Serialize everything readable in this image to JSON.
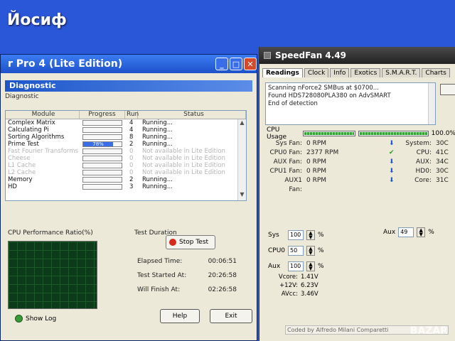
{
  "watermark": "Йосиф",
  "watermark_br": "BAZAR",
  "diag_window": {
    "title": "r Pro 4 (Lite Edition)",
    "banner": "Diagnostic",
    "sub": "Diagnostic",
    "columns": [
      "Module",
      "Progress",
      "Run",
      "Status"
    ],
    "rows": [
      {
        "module": "Complex Matrix",
        "progress": "",
        "fill": 0,
        "run": "4",
        "status": "Running...",
        "dim": false
      },
      {
        "module": "Calculating Pi",
        "progress": "",
        "fill": 0,
        "run": "4",
        "status": "Running...",
        "dim": false
      },
      {
        "module": "Sorting Algorithms",
        "progress": "",
        "fill": 0,
        "run": "8",
        "status": "Running...",
        "dim": false
      },
      {
        "module": "Prime Test",
        "progress": "78%",
        "fill": 78,
        "run": "2",
        "status": "Running...",
        "dim": false
      },
      {
        "module": "Fast Fourier Transforms",
        "progress": "",
        "fill": 0,
        "run": "0",
        "status": "Not available in Lite Edition",
        "dim": true
      },
      {
        "module": "Cheese",
        "progress": "",
        "fill": 0,
        "run": "0",
        "status": "Not available in Lite Edition",
        "dim": true
      },
      {
        "module": "L1 Cache",
        "progress": "",
        "fill": 0,
        "run": "0",
        "status": "Not available in Lite Edition",
        "dim": true
      },
      {
        "module": "L2 Cache",
        "progress": "",
        "fill": 0,
        "run": "0",
        "status": "Not available in Lite Edition",
        "dim": true
      },
      {
        "module": "Memory",
        "progress": "",
        "fill": 0,
        "run": "2",
        "status": "Running...",
        "dim": false
      },
      {
        "module": "HD",
        "progress": "",
        "fill": 0,
        "run": "3",
        "status": "Running...",
        "dim": false
      }
    ],
    "perf_label": "CPU Performance Ratio(%)",
    "duration_label": "Test Duration",
    "stop_label": "Stop Test",
    "elapsed_label": "Elapsed Time:",
    "elapsed_value": "00:06:51",
    "started_label": "Test Started At:",
    "started_value": "20:26:58",
    "finish_label": "Will Finish At:",
    "finish_value": "02:26:58",
    "help_label": "Help",
    "exit_label": "Exit",
    "showlog_label": "Show Log"
  },
  "speedfan": {
    "title": "SpeedFan 4.49",
    "tabs": [
      "Readings",
      "Clock",
      "Info",
      "Exotics",
      "S.M.A.R.T.",
      "Charts"
    ],
    "log_lines": [
      "Scanning nForce2 SMBus at $0700...",
      "Found HDS728080PLA380 on AdvSMART",
      "End of detection"
    ],
    "cpu_usage_label": "CPU Usage",
    "cpu_usage_value": "100.0%",
    "fans": [
      {
        "label": "Sys Fan:",
        "value": "0 RPM"
      },
      {
        "label": "CPU0 Fan:",
        "value": "2377 RPM"
      },
      {
        "label": "AUX Fan:",
        "value": "0 RPM"
      },
      {
        "label": "CPU1 Fan:",
        "value": "0 RPM"
      },
      {
        "label": "AUX1 Fan:",
        "value": "0 RPM"
      }
    ],
    "temps": [
      {
        "label": "System:",
        "value": "30C",
        "icon": "arrow-down-icon"
      },
      {
        "label": "CPU:",
        "value": "41C",
        "icon": "check-icon"
      },
      {
        "label": "AUX:",
        "value": "34C",
        "icon": "arrow-down-icon"
      },
      {
        "label": "HD0:",
        "value": "30C",
        "icon": "arrow-down-icon"
      },
      {
        "label": "Core:",
        "value": "31C",
        "icon": "arrow-down-icon"
      }
    ],
    "speeds": [
      {
        "label": "Sys",
        "value": "100",
        "unit": "%"
      },
      {
        "label": "CPU0",
        "value": "50",
        "unit": "%"
      },
      {
        "label": "Aux",
        "value": "100",
        "unit": "%"
      }
    ],
    "aux_right_label": "Aux",
    "aux_right_value": "49",
    "aux_right_unit": "%",
    "volts": [
      {
        "label": "Vcore:",
        "value": "1.41V"
      },
      {
        "label": "+12V:",
        "value": "6.23V"
      },
      {
        "label": "AVcc:",
        "value": "3.46V"
      }
    ],
    "footer": "Coded by Alfredo Milani Comparetti"
  }
}
